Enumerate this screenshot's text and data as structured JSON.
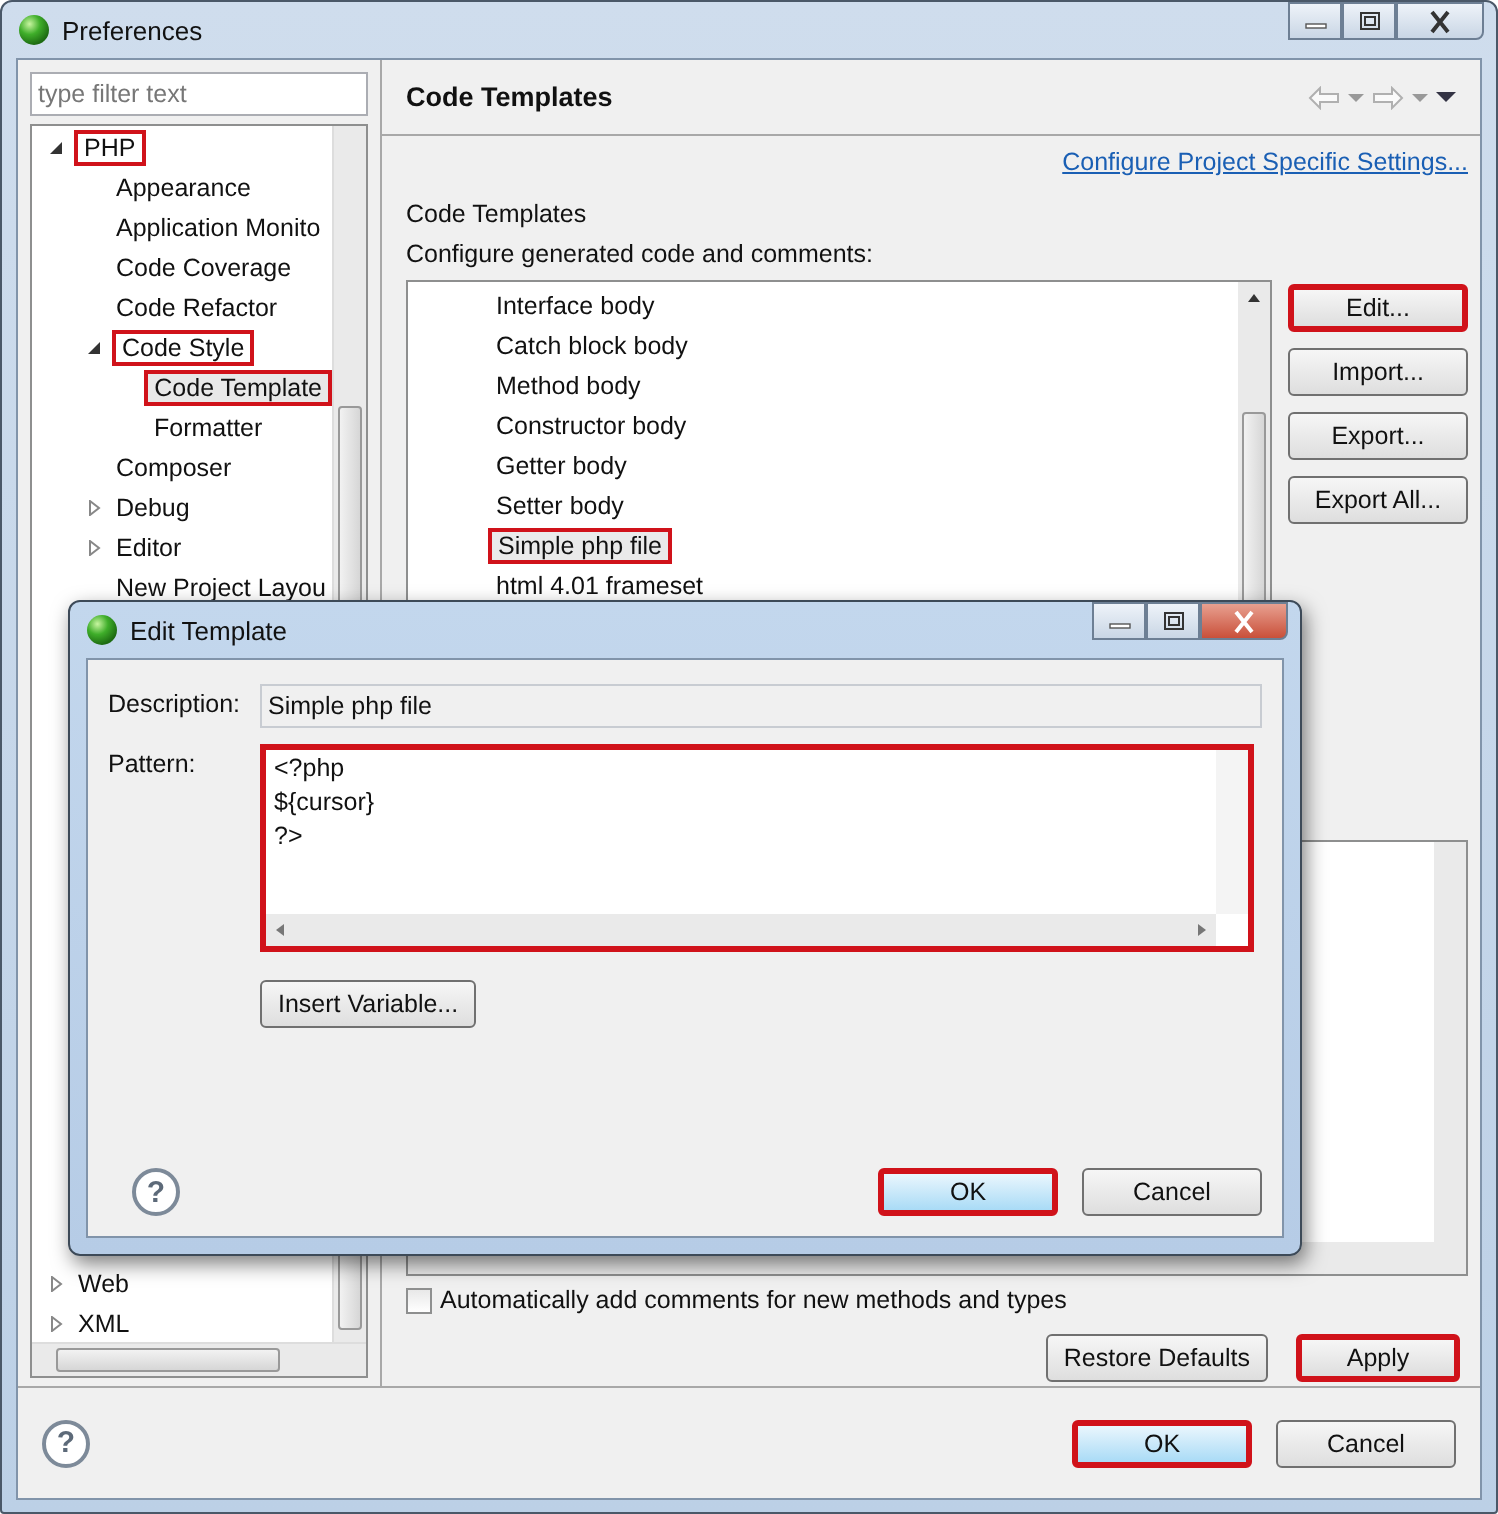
{
  "window": {
    "title": "Preferences"
  },
  "filter": {
    "placeholder": "type filter text"
  },
  "tree": {
    "items": [
      {
        "label": "PHP",
        "expanded": true,
        "selected": false,
        "highlighted": true,
        "children": [
          {
            "label": "Appearance",
            "selected": false,
            "highlighted": false
          },
          {
            "label": "Application Monito",
            "selected": false,
            "highlighted": false
          },
          {
            "label": "Code Coverage",
            "selected": false,
            "highlighted": false
          },
          {
            "label": "Code Refactor",
            "selected": false,
            "highlighted": false
          },
          {
            "label": "Code Style",
            "expanded": true,
            "selected": false,
            "highlighted": true,
            "children": [
              {
                "label": "Code Template",
                "selected": true,
                "highlighted": true
              },
              {
                "label": "Formatter",
                "selected": false,
                "highlighted": false
              }
            ]
          },
          {
            "label": "Composer",
            "selected": false,
            "highlighted": false
          },
          {
            "label": "Debug",
            "expanded": false,
            "selected": false,
            "highlighted": false
          },
          {
            "label": "Editor",
            "expanded": false,
            "selected": false,
            "highlighted": false
          },
          {
            "label": "New Project Layou",
            "selected": false,
            "highlighted": false
          }
        ]
      }
    ],
    "bottom_items": [
      {
        "label": "Web",
        "expanded": false,
        "selected": false,
        "highlighted": false
      },
      {
        "label": "XML",
        "expanded": false,
        "selected": false,
        "highlighted": false
      }
    ]
  },
  "page": {
    "title": "Code Templates",
    "link": "Configure Project Specific Settings...",
    "heading": "Code Templates",
    "description": "Configure generated code and comments:",
    "templates": [
      {
        "label": "Interface body",
        "selected": false,
        "highlighted": false
      },
      {
        "label": "Catch block body",
        "selected": false,
        "highlighted": false
      },
      {
        "label": "Method body",
        "selected": false,
        "highlighted": false
      },
      {
        "label": "Constructor body",
        "selected": false,
        "highlighted": false
      },
      {
        "label": "Getter body",
        "selected": false,
        "highlighted": false
      },
      {
        "label": "Setter body",
        "selected": false,
        "highlighted": false
      },
      {
        "label": "Simple php file",
        "selected": true,
        "highlighted": true
      },
      {
        "label": "html 4.01 frameset",
        "selected": false,
        "highlighted": false
      }
    ],
    "side_buttons": [
      {
        "label": "Edit...",
        "highlighted": true
      },
      {
        "label": "Import...",
        "highlighted": false
      },
      {
        "label": "Export...",
        "highlighted": false
      },
      {
        "label": "Export All...",
        "highlighted": false
      }
    ],
    "checkbox": {
      "label": "Automatically add comments for new methods and types",
      "checked": false
    },
    "buttons": [
      {
        "label": "Restore Defaults",
        "highlighted": false
      },
      {
        "label": "Apply",
        "highlighted": true
      }
    ]
  },
  "footer": {
    "help": "?",
    "buttons": [
      {
        "label": "OK",
        "default": true,
        "highlighted": true
      },
      {
        "label": "Cancel",
        "default": false,
        "highlighted": false
      }
    ]
  },
  "dialog": {
    "title": "Edit Template",
    "description_label": "Description:",
    "description": "Simple php file",
    "pattern_label": "Pattern:",
    "pattern_lines": [
      "<?php",
      "${cursor}",
      "?>"
    ],
    "pattern_highlighted": true,
    "insert_button": "Insert Variable...",
    "help": "?",
    "buttons": [
      {
        "label": "OK",
        "default": true,
        "highlighted": true
      },
      {
        "label": "Cancel",
        "default": false,
        "highlighted": false
      }
    ]
  }
}
